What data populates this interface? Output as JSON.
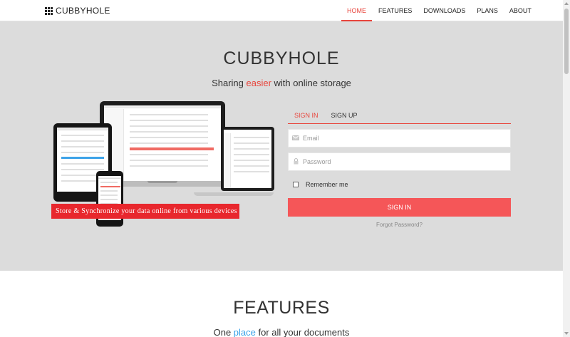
{
  "nav": {
    "brand": "CUBBYHOLE",
    "items": [
      {
        "label": "HOME",
        "active": true
      },
      {
        "label": "FEATURES"
      },
      {
        "label": "DOWNLOADS"
      },
      {
        "label": "PLANS"
      },
      {
        "label": "ABOUT"
      }
    ]
  },
  "hero": {
    "title": "CUBBYHOLE",
    "subtitle_pre": "Sharing ",
    "subtitle_accent": "easier",
    "subtitle_post": " with online storage",
    "promo": "Store & Synchronize your data online from various devices"
  },
  "auth": {
    "tabs": [
      {
        "label": "SIGN IN",
        "active": true
      },
      {
        "label": "SIGN UP"
      }
    ],
    "email_placeholder": "Email",
    "password_placeholder": "Password",
    "remember_label": "Remember me",
    "signin_label": "SIGN IN",
    "forgot_label": "Forgot Password?",
    "email_icon": "envelope-icon",
    "password_icon": "lock-icon"
  },
  "features": {
    "title": "FEATURES",
    "subtitle_pre": "One ",
    "subtitle_accent": "place",
    "subtitle_post": " for all your documents"
  },
  "colors": {
    "accent_red": "#e8453c",
    "button_red": "#f55658",
    "accent_blue": "#3da3e8",
    "hero_bg": "#dcdcdc"
  }
}
